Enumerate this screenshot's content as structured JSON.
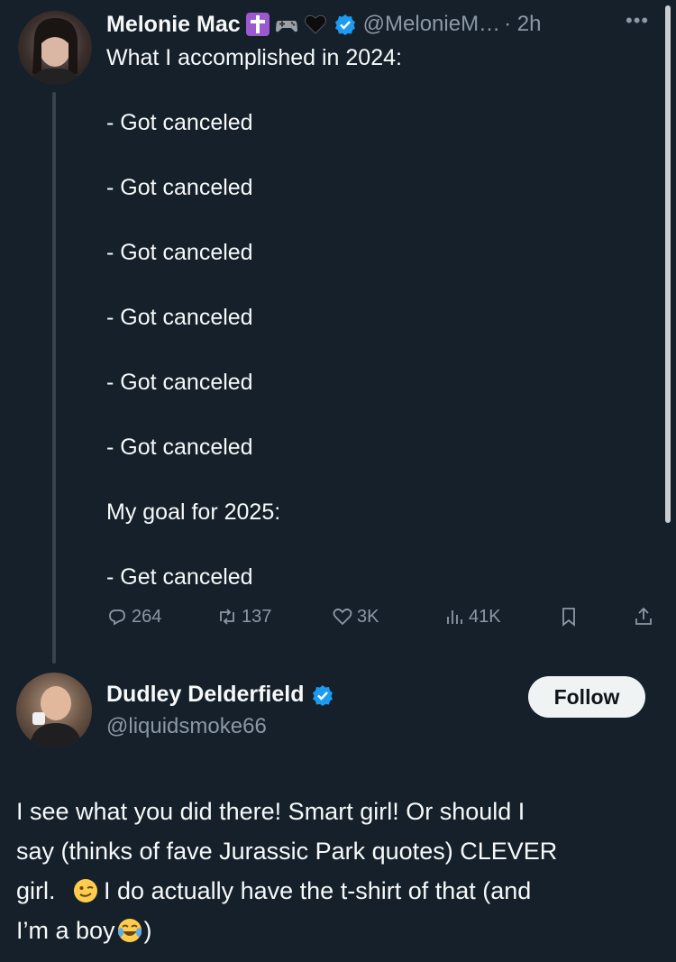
{
  "tweet": {
    "author_name": "Melonie Mac",
    "handle": "@MelonieM…",
    "time": "· 2h",
    "more": "•••",
    "lines": [
      "What I accomplished in 2024:",
      "",
      "- Got canceled",
      "",
      "- Got canceled",
      "",
      "- Got canceled",
      "",
      "- Got canceled",
      "",
      "- Got canceled",
      "",
      "- Got canceled",
      "",
      "My goal for 2025:",
      "",
      "- Get canceled"
    ],
    "stats": {
      "replies": "264",
      "reposts": "137",
      "likes": "3K",
      "views": "41K"
    }
  },
  "reply": {
    "author_name": "Dudley Delderfield",
    "handle": "@liquidsmoke66",
    "follow_label": "Follow",
    "line1": "I see what you did there! Smart girl! Or should I",
    "line2": "say (thinks of fave Jurassic Park quotes) CLEVER",
    "line3a": "girl.",
    "line3b": "I do actually have the t-shirt of that (and",
    "line4a": "I’m a boy",
    "line4b": ")"
  },
  "colors": {
    "background": "#15202b",
    "text": "#f7f9f9",
    "muted": "#8b98a5",
    "verified": "#1d9bf0",
    "divider": "#38444d"
  },
  "icons": [
    "cross-emoji-icon",
    "gamepad-emoji-icon",
    "black-heart-emoji-icon",
    "verified-icon",
    "more-icon",
    "reply-icon",
    "repost-icon",
    "like-icon",
    "views-icon",
    "bookmark-icon",
    "share-icon",
    "wink-emoji-icon",
    "laughing-emoji-icon"
  ]
}
